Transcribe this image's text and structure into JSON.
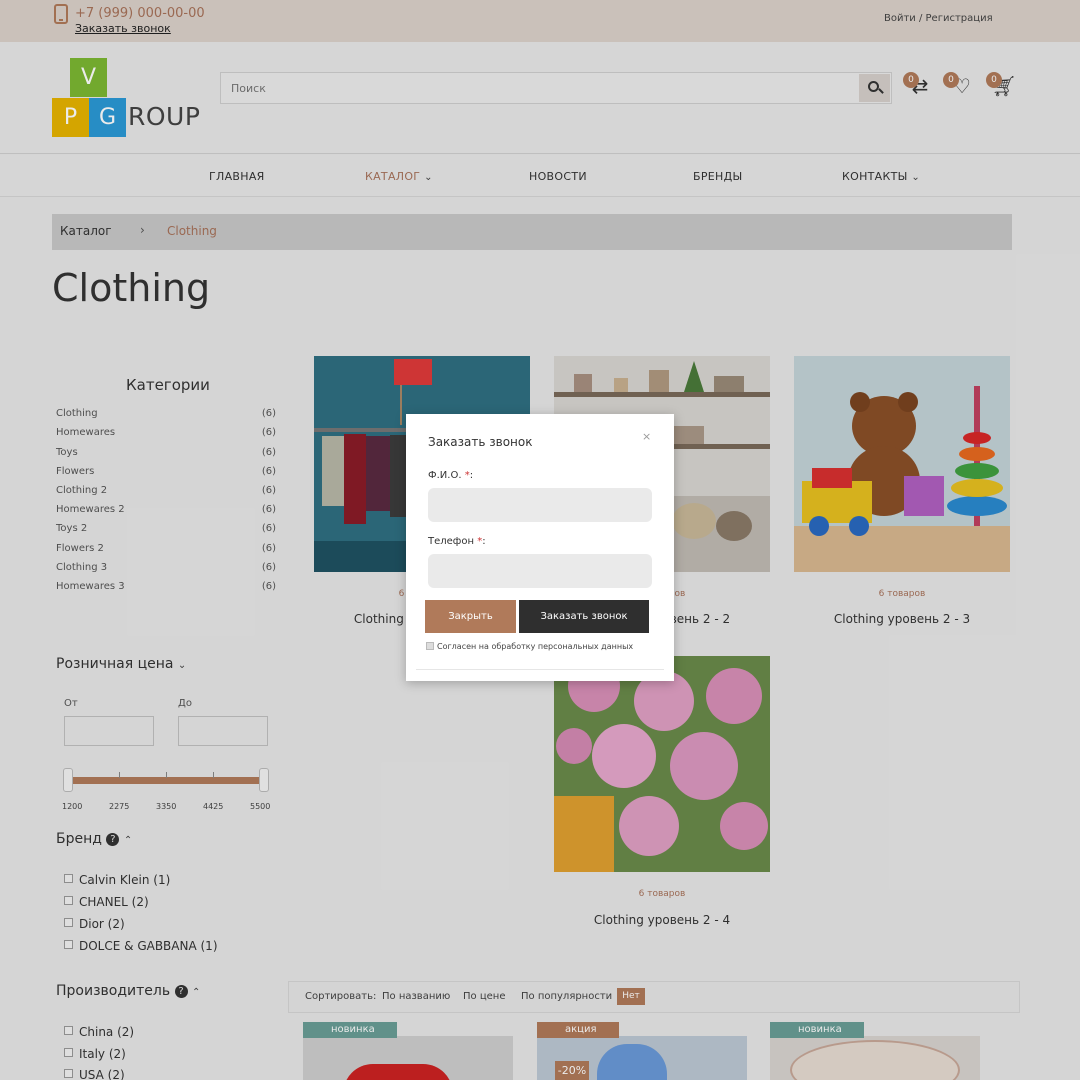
{
  "topbar": {
    "phone": "+7 (999) 000-00-00",
    "callback_link": "Заказать звонок",
    "login": "Войти / Регистрация"
  },
  "logo": {
    "v": "V",
    "p": "P",
    "g": "G",
    "rest": "ROUP"
  },
  "search": {
    "placeholder": "Поиск"
  },
  "header_badges": {
    "compare": "0",
    "favorites": "0",
    "cart": "0"
  },
  "nav": [
    {
      "label": "ГЛАВНАЯ"
    },
    {
      "label": "КАТАЛОГ"
    },
    {
      "label": "НОВОСТИ"
    },
    {
      "label": "БРЕНДЫ"
    },
    {
      "label": "КОНТАКТЫ"
    }
  ],
  "breadcrumb": {
    "root": "Каталог",
    "separator": "›",
    "current": "Clothing"
  },
  "page_title": "Clothing",
  "sidebar": {
    "categories_title": "Категории",
    "categories": [
      {
        "name": "Clothing",
        "count": "(6)"
      },
      {
        "name": "Homewares",
        "count": "(6)"
      },
      {
        "name": "Toys",
        "count": "(6)"
      },
      {
        "name": "Flowers",
        "count": "(6)"
      },
      {
        "name": "Clothing 2",
        "count": "(6)"
      },
      {
        "name": "Homewares 2",
        "count": "(6)"
      },
      {
        "name": "Toys 2",
        "count": "(6)"
      },
      {
        "name": "Flowers 2",
        "count": "(6)"
      },
      {
        "name": "Clothing 3",
        "count": "(6)"
      },
      {
        "name": "Homewares 3",
        "count": "(6)"
      }
    ],
    "price": {
      "title": "Розничная цена",
      "from_label": "От",
      "to_label": "До",
      "ticks": [
        "1200",
        "2275",
        "3350",
        "4425",
        "5500"
      ]
    },
    "brand": {
      "title": "Бренд",
      "items": [
        "Calvin Klein (1)",
        "CHANEL (2)",
        "Dior (2)",
        "DOLCE & GABBANA (1)"
      ]
    },
    "manufacturer": {
      "title": "Производитель",
      "items": [
        "China (2)",
        "Italy (2)",
        "USA (2)"
      ]
    }
  },
  "products": [
    {
      "count": "6 товаров",
      "name": "Clothing уровень 2 - 1"
    },
    {
      "count": "6 товаров",
      "name": "Clothing уровень 2 - 2"
    },
    {
      "count": "6 товаров",
      "name": "Clothing уровень 2 - 3"
    },
    {
      "count": "6 товаров",
      "name": "Clothing уровень 2 - 4"
    }
  ],
  "sort": {
    "label": "Сортировать:",
    "by_name": "По названию",
    "by_price": "По цене",
    "by_popularity": "По популярности",
    "none": "Нет"
  },
  "listing_tags": [
    "новинка",
    "акция",
    "новинка"
  ],
  "discount": "-20%",
  "modal": {
    "title": "Заказать звонок",
    "close_x": "×",
    "name_label": "Ф.И.О.",
    "phone_label": "Телефон",
    "req": "*",
    "colon": ":",
    "btn_close": "Закрыть",
    "btn_order": "Заказать звонок",
    "agree": "Согласен на обработку персональных данных"
  },
  "colors": {
    "accent": "#b07a5a",
    "dark_button": "#2f2f2f",
    "topbar": "#dcd2ca"
  }
}
